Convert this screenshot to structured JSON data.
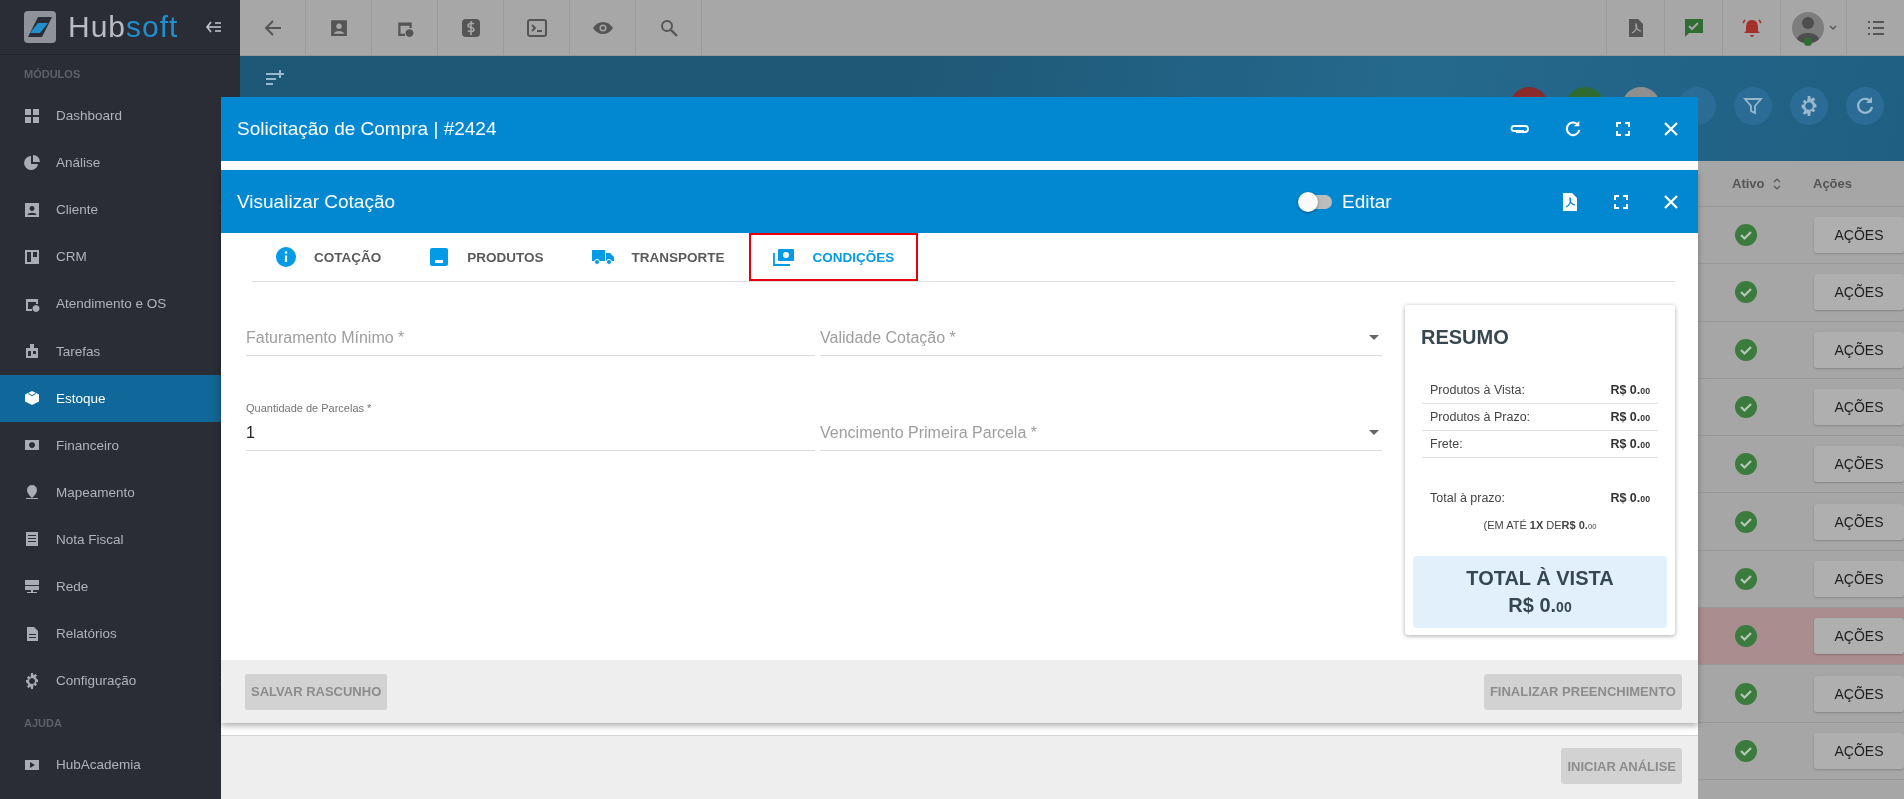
{
  "sidebar": {
    "logo": {
      "part_1": "Hub",
      "part_2": "soft"
    },
    "sections": [
      {
        "title": "MÓDULOS",
        "items": [
          {
            "label": "Dashboard",
            "selected": false,
            "has_submenu": false
          },
          {
            "label": "Análise",
            "selected": false,
            "has_submenu": false
          },
          {
            "label": "Cliente",
            "selected": false,
            "has_submenu": true
          },
          {
            "label": "CRM",
            "selected": false,
            "has_submenu": false
          },
          {
            "label": "Atendimento e OS",
            "selected": false,
            "has_submenu": false
          },
          {
            "label": "Tarefas",
            "selected": false,
            "has_submenu": false
          },
          {
            "label": "Estoque",
            "selected": true,
            "has_submenu": false
          },
          {
            "label": "Financeiro",
            "selected": false,
            "has_submenu": false
          },
          {
            "label": "Mapeamento",
            "selected": false,
            "has_submenu": false
          },
          {
            "label": "Nota Fiscal",
            "selected": false,
            "has_submenu": false
          },
          {
            "label": "Rede",
            "selected": false,
            "has_submenu": false
          },
          {
            "label": "Relatórios",
            "selected": false,
            "has_submenu": false
          },
          {
            "label": "Configuração",
            "selected": false,
            "has_submenu": true
          }
        ]
      },
      {
        "title": "AJUDA",
        "items": [
          {
            "label": "HubAcademia",
            "selected": false,
            "has_submenu": false
          }
        ]
      }
    ]
  },
  "table": {
    "columns": [
      {
        "label": "Ativo",
        "sortable": true
      },
      {
        "label": "Ações",
        "sortable": false
      }
    ],
    "rows": [
      {
        "active": true,
        "highlighted": false,
        "action": "AÇÕES"
      },
      {
        "active": true,
        "highlighted": false,
        "action": "AÇÕES"
      },
      {
        "active": true,
        "highlighted": false,
        "action": "AÇÕES"
      },
      {
        "active": true,
        "highlighted": false,
        "action": "AÇÕES"
      },
      {
        "active": true,
        "highlighted": false,
        "action": "AÇÕES"
      },
      {
        "active": true,
        "highlighted": false,
        "action": "AÇÕES"
      },
      {
        "active": true,
        "highlighted": false,
        "action": "AÇÕES"
      },
      {
        "active": true,
        "highlighted": true,
        "action": "AÇÕES"
      },
      {
        "active": true,
        "highlighted": false,
        "action": "AÇÕES"
      },
      {
        "active": true,
        "highlighted": false,
        "action": "AÇÕES"
      }
    ]
  },
  "modal": {
    "title": "Solicitação de Compra | #2424",
    "footer_button": {
      "label": "INICIAR ANÁLISE",
      "disabled": true
    },
    "inner": {
      "title": "Visualizar Cotação",
      "edit_toggle": {
        "label": "Editar",
        "on": false
      },
      "tabs": [
        {
          "label": "COTAÇÃO",
          "selected": false
        },
        {
          "label": "PRODUTOS",
          "selected": false
        },
        {
          "label": "TRANSPORTE",
          "selected": false
        },
        {
          "label": "CONDIÇÕES",
          "selected": true
        }
      ],
      "fields": [
        {
          "kind": "text",
          "label": "Faturamento Mínimo *"
        },
        {
          "kind": "select",
          "label": "Validade Cotação *"
        },
        {
          "kind": "text",
          "label": "Quantidade de Parcelas *",
          "value": "1"
        },
        {
          "kind": "select",
          "label": "Vencimento Primeira Parcela *"
        }
      ],
      "summary": {
        "title": "RESUMO",
        "lines": [
          {
            "label": "Produtos à Vista:",
            "value": "R$ 0.$_{00}$"
          },
          {
            "label": "Produtos à Prazo:",
            "value": "R$ 0.$_{00}$"
          },
          {
            "label": "Frete:",
            "value": "R$ 0.$_{00}$"
          }
        ],
        "term_total": {
          "label": "Total à prazo:",
          "value": "R$ 0.$_{00}$"
        },
        "installments_note": "(EM ATÉ **1X** DE**R$ 0.**$_{00}$",
        "cash_total": {
          "label": "TOTAL À VISTA",
          "value": "R$ 0.$_{00}$"
        }
      },
      "buttons": [
        {
          "label": "SALVAR RASCUNHO",
          "disabled": true
        },
        {
          "label": "FINALIZAR PREENCHIMENTO",
          "disabled": true
        }
      ]
    }
  }
}
